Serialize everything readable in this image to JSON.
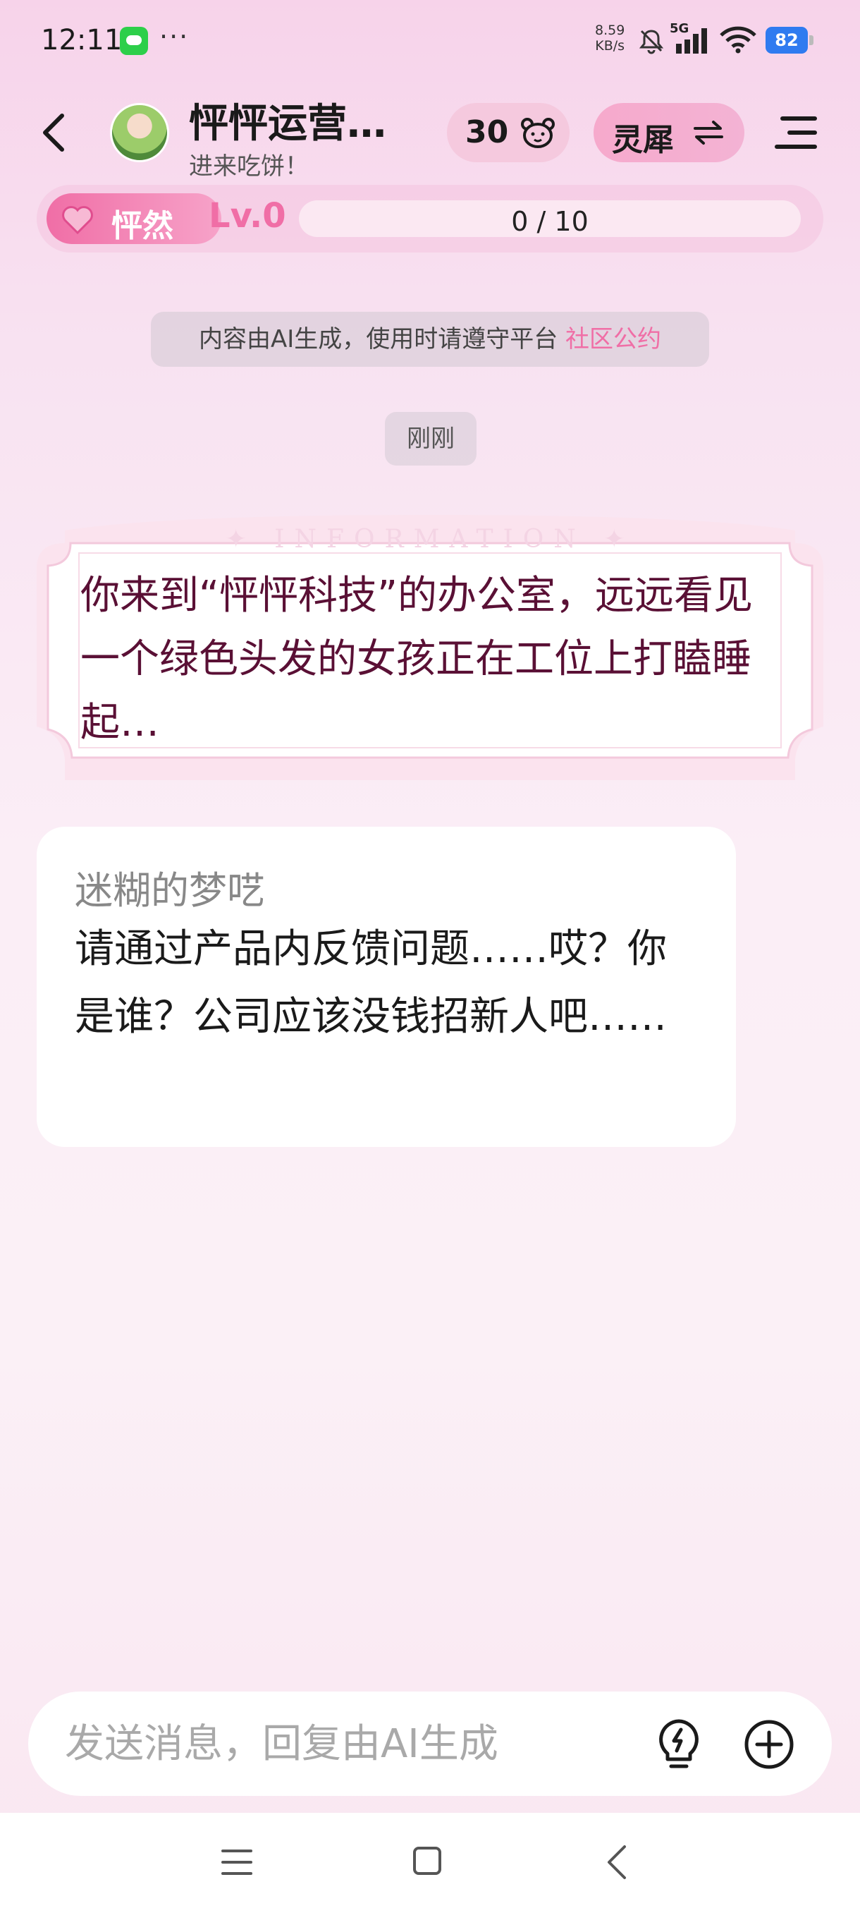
{
  "status_bar": {
    "time": "12:11",
    "dots": "···",
    "net_speed_value": "8.59",
    "net_speed_unit": "KB/s",
    "network": "5G",
    "battery": "82"
  },
  "header": {
    "character_name": "怦怦运营…",
    "character_subtitle": "进来吃饼！",
    "coin_count": "30",
    "mode_label": "灵犀"
  },
  "level": {
    "tag_label": "怦然",
    "level_text": "Lv.0",
    "progress_text": "0 / 10",
    "progress_fraction": 0.0
  },
  "notice": {
    "text": "内容由AI生成，使用时请遵守平台 ",
    "link": "社区公约"
  },
  "timestamp": "刚刚",
  "info_card": {
    "heading": "✦ INFORMATION ✦",
    "text": "你来到“怦怦科技”的办公室，远远看见一个绿色头发的女孩正在工位上打瞌睡起…"
  },
  "message": {
    "action": "迷糊的梦呓",
    "text": "请通过产品内反馈问题……哎？你是谁？公司应该没钱招新人吧……"
  },
  "input": {
    "placeholder": "发送消息，回复由AI生成"
  },
  "icons": {
    "bell": "bell-muted-icon",
    "signal": "signal-icon",
    "wifi": "wifi-icon",
    "back": "back-icon",
    "bear": "bear-icon",
    "swap": "swap-icon",
    "menu": "menu-icon",
    "heart": "heart-icon",
    "bulb": "lightbulb-icon",
    "plus": "plus-circle-icon"
  },
  "colors": {
    "accent": "#f06ea6",
    "info_text": "#5a1035",
    "battery": "#2f7bf0"
  }
}
